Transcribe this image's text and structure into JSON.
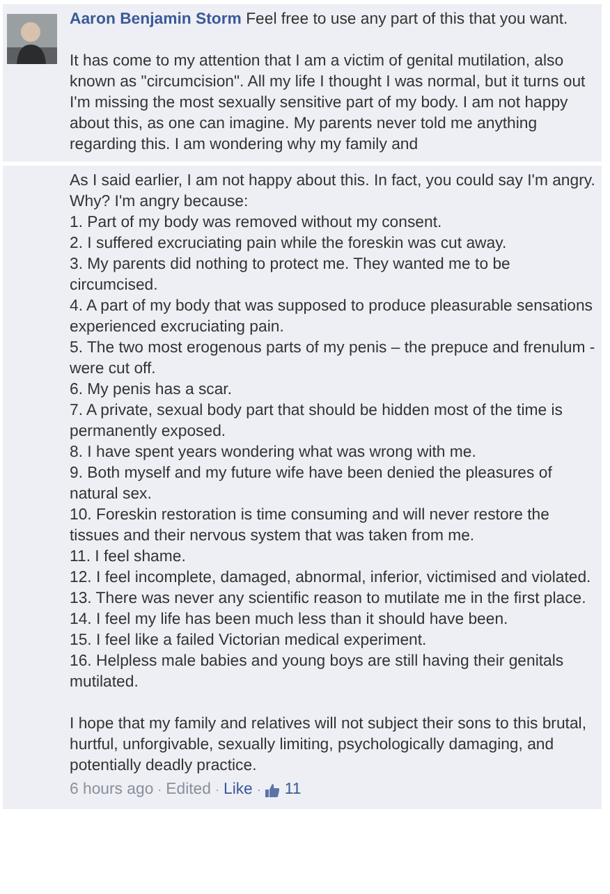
{
  "comment": {
    "author": "Aaron Benjamin Storm",
    "intro": "Feel free to use any part of this that you want.",
    "paragraphs": [
      "It has come to my attention that I am a victim of genital mutilation, also known as \"circumcision\". All my life I thought I was normal, but it turns out I'm missing the most sexually sensitive part of my body. I am not happy about this, as one can imagine. My parents never told me anything regarding this. I am wondering why my family and"
    ],
    "continuation": {
      "paragraphs": [
        "As I said earlier, I am not happy about this. In fact, you could say I'm angry. Why? I'm angry because:"
      ],
      "list": [
        "1. Part of my body was removed without my consent.",
        "2. I suffered excruciating pain while the foreskin was cut away.",
        "3. My parents did nothing to protect me. They wanted me to be circumcised.",
        "4. A part of my body that was supposed to produce pleasurable sensations experienced excruciating pain.",
        "5. The two most erogenous parts of my penis – the prepuce and frenulum - were cut off.",
        "6. My penis has a scar.",
        "7. A private, sexual body part that should be hidden most of the time is permanently exposed.",
        "8. I have spent years wondering what was wrong with me.",
        "9. Both myself and my future wife have been denied the pleasures of natural sex.",
        "10. Foreskin restoration is time consuming and will never restore the tissues and their nervous system that was taken from me.",
        "11. I feel shame.",
        "12. I feel incomplete, damaged, abnormal, inferior, victimised and violated.",
        "13. There was never any scientific reason to mutilate me in the first place.",
        "14. I feel my life has been much less than it should have been.",
        "15. I feel like a failed Victorian medical experiment.",
        "16. Helpless male babies and young boys are still having their genitals mutilated."
      ],
      "closing": "I hope that my family and relatives will not subject their sons to this brutal, hurtful, unforgivable, sexually limiting, psychologically damaging, and potentially deadly practice."
    },
    "footer": [
      {
        "kind": "time",
        "text": "6 hours ago"
      },
      {
        "kind": "sep",
        "text": "·"
      },
      {
        "kind": "edited",
        "text": "Edited"
      },
      {
        "kind": "sep",
        "text": "·"
      },
      {
        "kind": "link",
        "text": "Like"
      },
      {
        "kind": "sep",
        "text": "·"
      },
      {
        "kind": "likes",
        "text": "11"
      }
    ]
  }
}
